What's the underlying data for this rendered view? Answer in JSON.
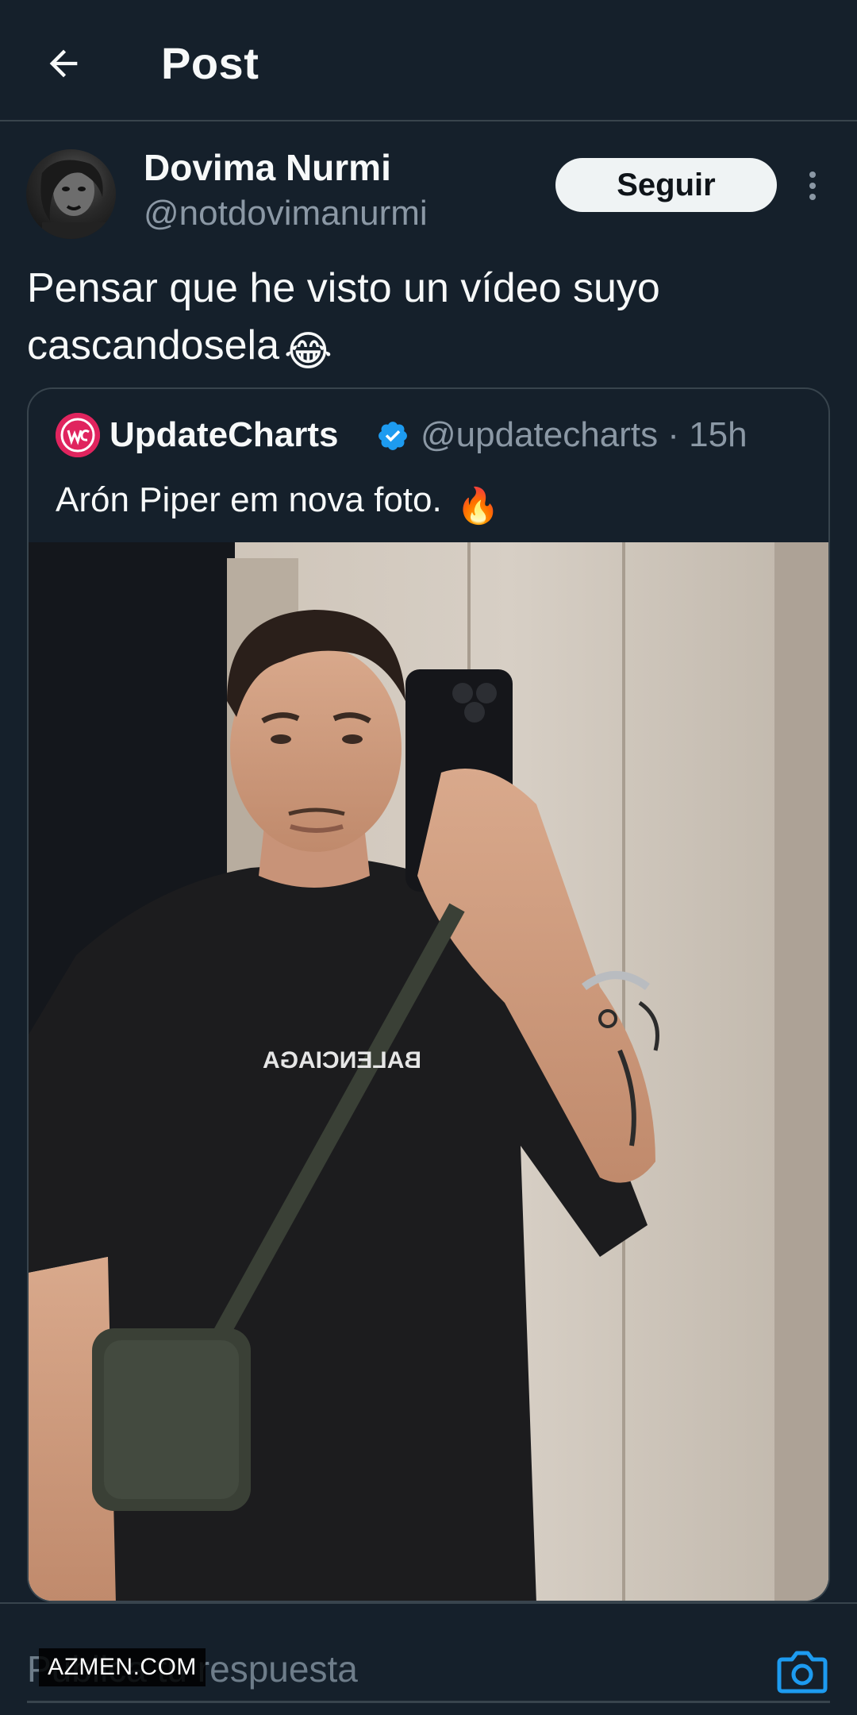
{
  "header": {
    "title": "Post",
    "back_icon": "arrow-left-icon"
  },
  "post": {
    "author_name": "Dovima Nurmi",
    "author_handle": "@notdovimanurmi",
    "follow_label": "Seguir",
    "text_line1": "Pensar que he visto un vídeo suyo",
    "text_line2": "cascandosela",
    "text_emoji": "😂"
  },
  "quote": {
    "name": "UpdateCharts",
    "handle_time": "@updatecharts · 15h",
    "text": "Arón Piper em nova foto.",
    "text_emoji": "🔥",
    "verified_icon": "verified-badge-icon",
    "shirt_print": "BALENCIAGA"
  },
  "reply": {
    "placeholder": "Publica tu respuesta",
    "camera_icon": "camera-icon"
  },
  "watermark": "AZMEN.COM",
  "colors": {
    "background": "#15202b",
    "border": "#38444d",
    "secondary_text": "#8b98a5",
    "accent_blue": "#1d9bf0",
    "follow_button_bg": "#eff3f4"
  }
}
